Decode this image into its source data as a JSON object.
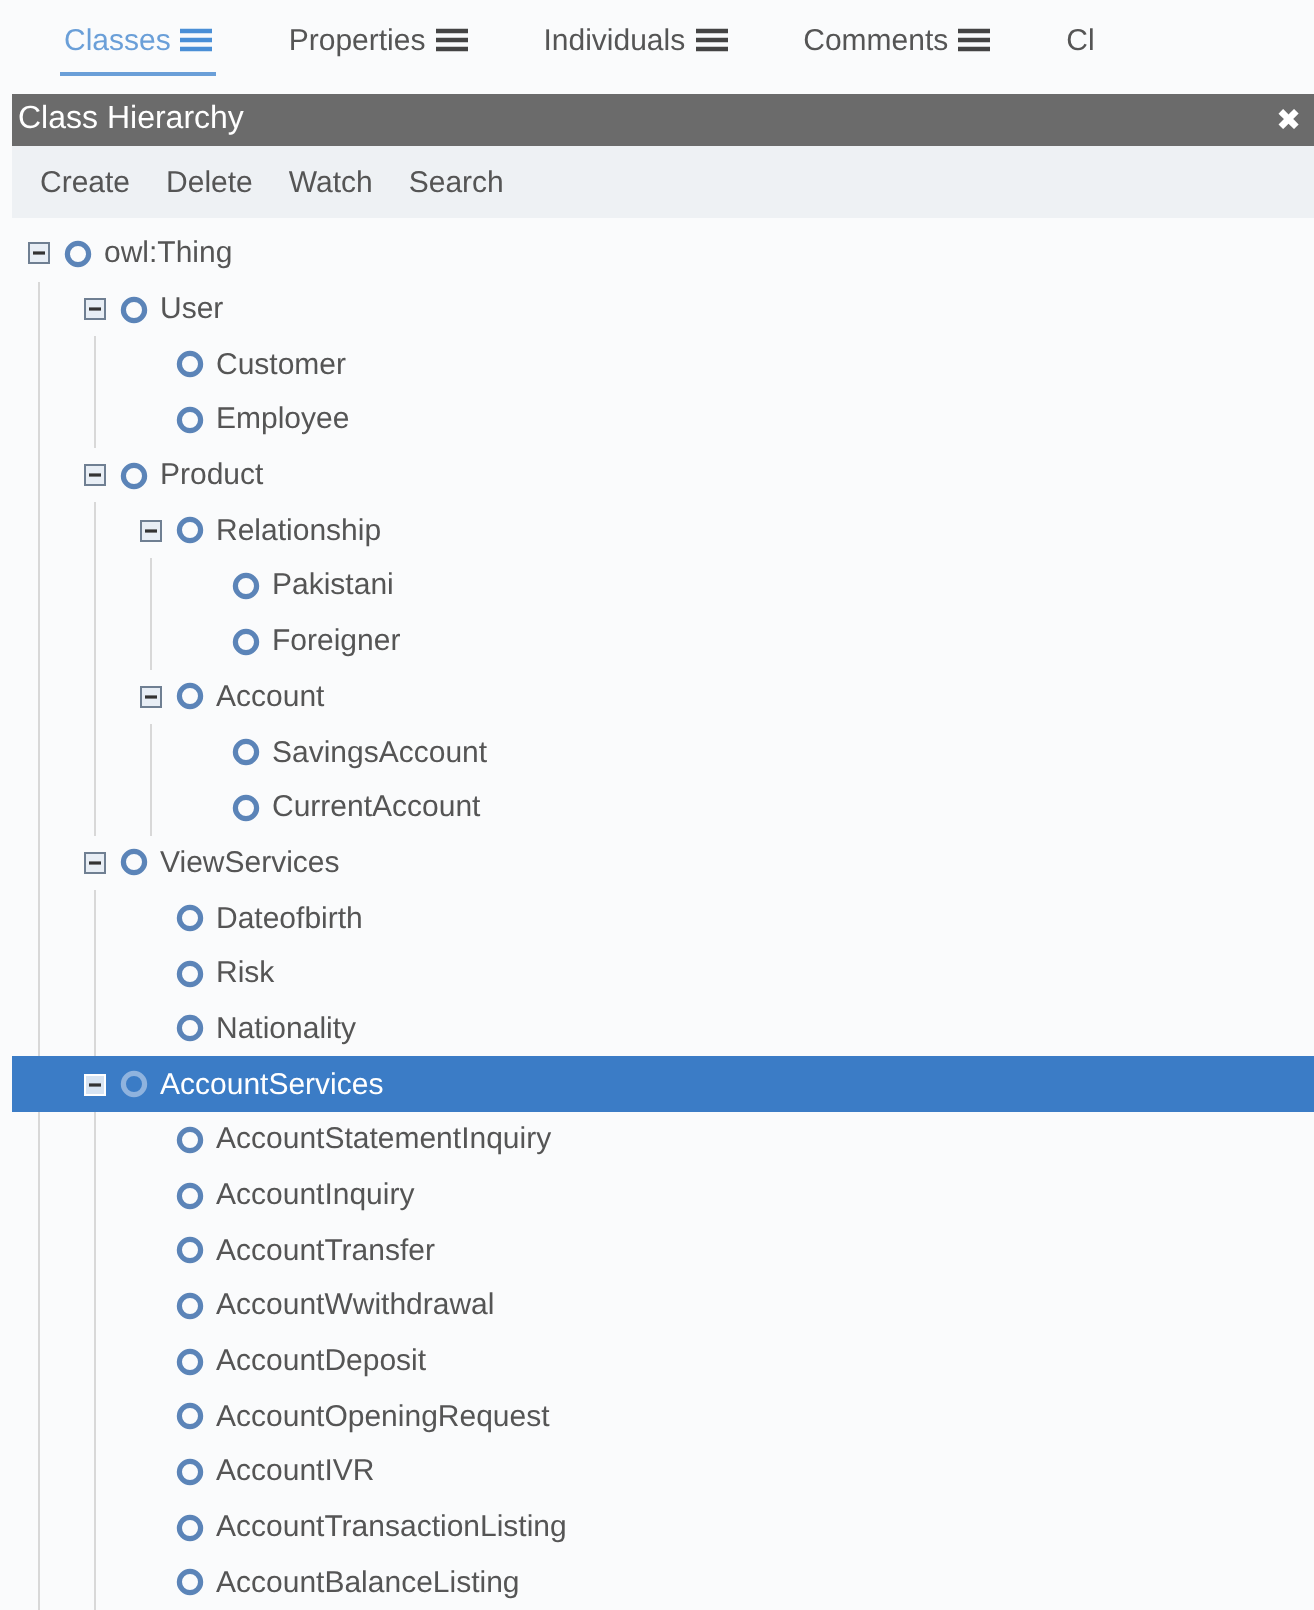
{
  "tabs": [
    {
      "label": "Classes",
      "menu_icon": true,
      "selected": true
    },
    {
      "label": "Properties",
      "menu_icon": true,
      "selected": false
    },
    {
      "label": "Individuals",
      "menu_icon": true,
      "selected": false
    },
    {
      "label": "Comments",
      "menu_icon": true,
      "selected": false
    },
    {
      "label": "Cl",
      "menu_icon": false,
      "selected": false
    }
  ],
  "panel": {
    "title": "Class Hierarchy",
    "close": "✖"
  },
  "toolbar": [
    "Create",
    "Delete",
    "Watch",
    "Search"
  ],
  "tree": [
    {
      "label": "owl:Thing",
      "expanded": true,
      "selected": false,
      "children": [
        {
          "label": "User",
          "expanded": true,
          "selected": false,
          "children": [
            {
              "label": "Customer",
              "selected": false
            },
            {
              "label": "Employee",
              "selected": false
            }
          ]
        },
        {
          "label": "Product",
          "expanded": true,
          "selected": false,
          "children": [
            {
              "label": "Relationship",
              "expanded": true,
              "selected": false,
              "children": [
                {
                  "label": "Pakistani",
                  "selected": false
                },
                {
                  "label": "Foreigner",
                  "selected": false
                }
              ]
            },
            {
              "label": "Account",
              "expanded": true,
              "selected": false,
              "children": [
                {
                  "label": "SavingsAccount",
                  "selected": false
                },
                {
                  "label": "CurrentAccount",
                  "selected": false
                }
              ]
            }
          ]
        },
        {
          "label": "ViewServices",
          "expanded": true,
          "selected": false,
          "children": [
            {
              "label": "Dateofbirth",
              "selected": false
            },
            {
              "label": "Risk",
              "selected": false
            },
            {
              "label": "Nationality",
              "selected": false
            }
          ]
        },
        {
          "label": "AccountServices",
          "expanded": true,
          "selected": true,
          "children": [
            {
              "label": "AccountStatementInquiry",
              "selected": false
            },
            {
              "label": "AccountInquiry",
              "selected": false
            },
            {
              "label": "AccountTransfer",
              "selected": false
            },
            {
              "label": "AccountWwithdrawal",
              "selected": false
            },
            {
              "label": "AccountDeposit",
              "selected": false
            },
            {
              "label": "AccountOpeningRequest",
              "selected": false
            },
            {
              "label": "AccountIVR",
              "selected": false
            },
            {
              "label": "AccountTransactionListing",
              "selected": false
            },
            {
              "label": "AccountBalanceListing",
              "selected": false
            }
          ]
        }
      ]
    }
  ]
}
